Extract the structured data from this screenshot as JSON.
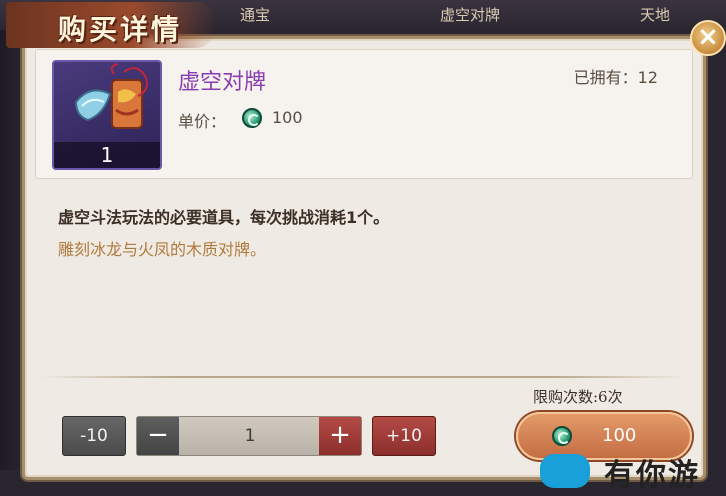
{
  "background_tabs": [
    "通宝",
    "虚空对牌",
    "天地"
  ],
  "title": "购买详情",
  "close_glyph": "×",
  "item": {
    "name": "虚空对牌",
    "icon_count": "1",
    "owned_label": "已拥有：12",
    "price_label": "单价：",
    "price_value": "100",
    "currency_icon": "jade-coin-icon"
  },
  "description": {
    "line1": "虚空斗法玩法的必要道具，每次挑战消耗1个。",
    "line2": "雕刻冰龙与火凤的木质对牌。"
  },
  "purchase": {
    "limit_label": "限购次数:6次",
    "minus10_label": "-10",
    "minus_glyph": "−",
    "quantity": "1",
    "plus_glyph": "+",
    "plus10_label": "+10",
    "total_cost": "100"
  },
  "watermark": {
    "text": "有你游"
  },
  "colors": {
    "panel_bg": "#efeae3",
    "item_name": "#8a3db0",
    "flavor_text": "#b07a3e",
    "buy_button": "#d47f52",
    "plus_button": "#a23d39"
  }
}
